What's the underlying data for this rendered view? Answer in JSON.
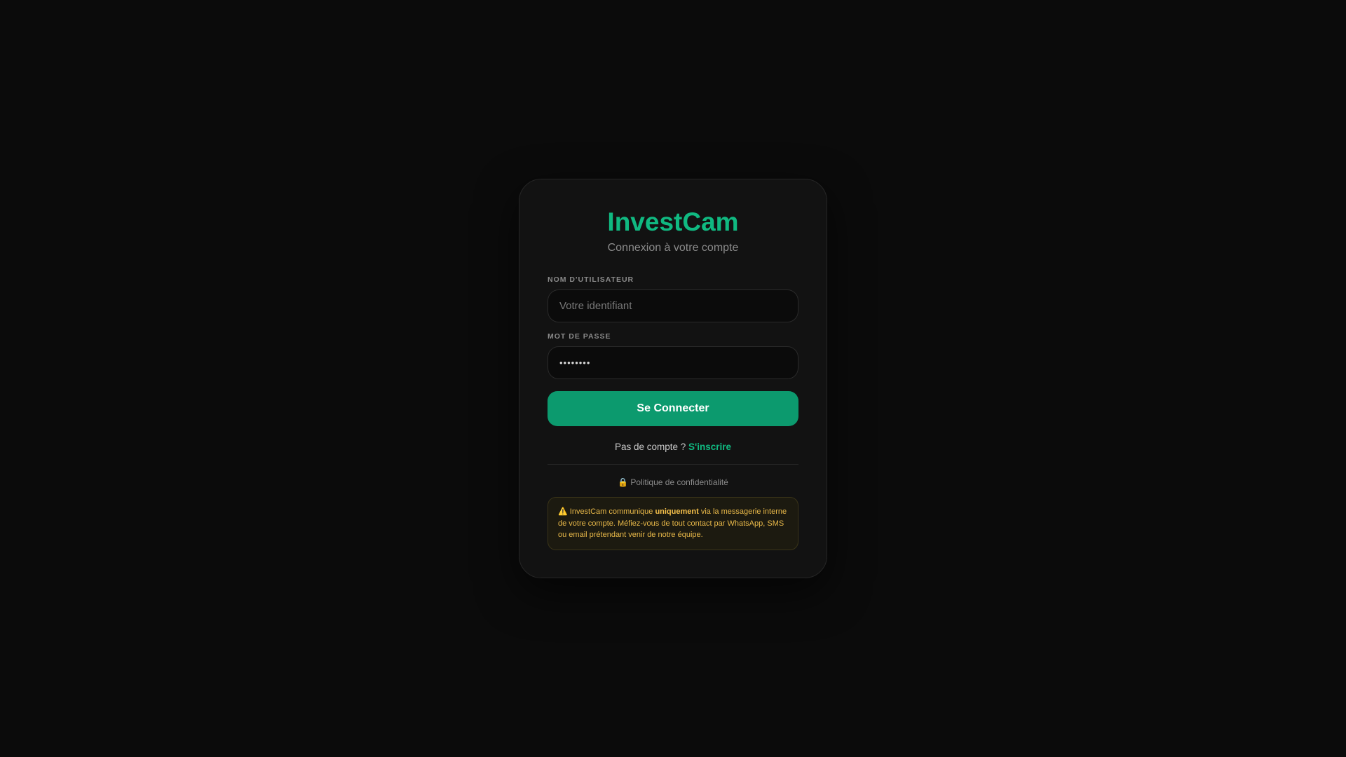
{
  "brand": {
    "title": "InvestCam",
    "subtitle": "Connexion à votre compte"
  },
  "form": {
    "username_label": "NOM D'UTILISATEUR",
    "username_placeholder": "Votre identifiant",
    "username_value": "",
    "password_label": "MOT DE PASSE",
    "password_value": "••••••••",
    "submit_label": "Se Connecter"
  },
  "signup": {
    "prompt": "Pas de compte ? ",
    "link_label": "S'inscrire"
  },
  "privacy": {
    "icon": "lock-icon",
    "glyph": "🔒",
    "link_label": "Politique de confidentialité"
  },
  "warning": {
    "icon": "warning-icon",
    "glyph": "⚠️",
    "text_before": "InvestCam communique ",
    "emphasis": "uniquement",
    "text_after": " via la messagerie interne de votre compte. Méfiez-vous de tout contact par WhatsApp, SMS ou email prétendant venir de notre équipe."
  },
  "colors": {
    "background": "#0b0b0b",
    "card": "#121212",
    "accent": "#10b981",
    "button": "#0c9a6e",
    "warning_text": "#e9b949"
  }
}
